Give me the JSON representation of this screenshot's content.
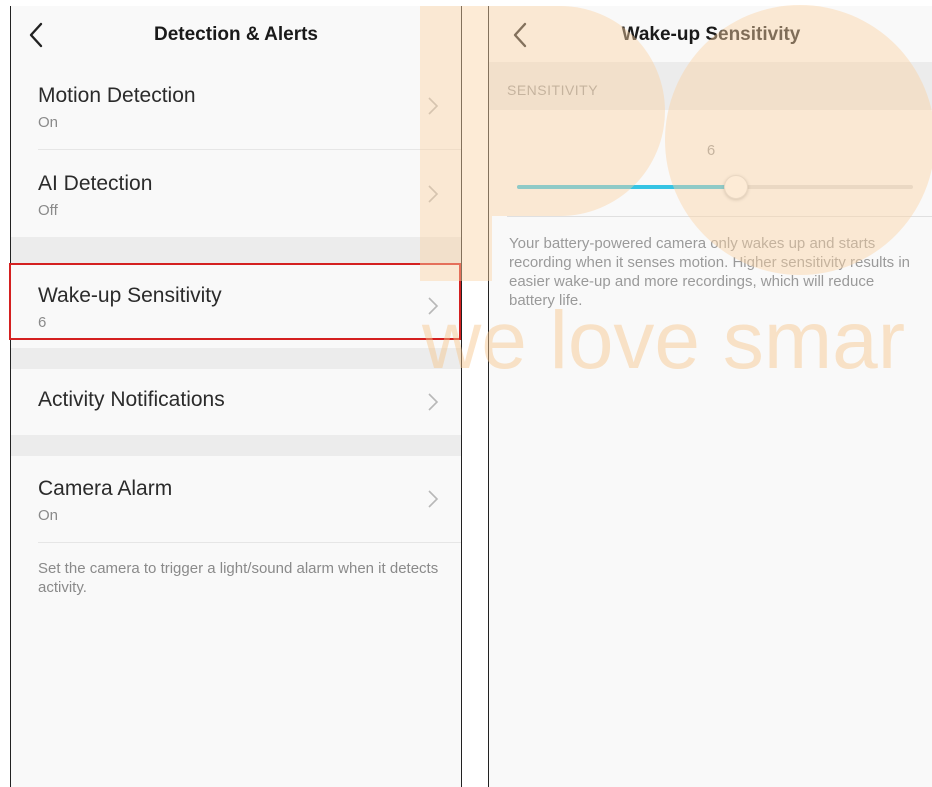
{
  "left": {
    "nav_title": "Detection & Alerts",
    "rows": [
      {
        "title": "Motion Detection",
        "subtitle": "On"
      },
      {
        "title": "AI Detection",
        "subtitle": "Off"
      },
      {
        "title": "Wake-up Sensitivity",
        "subtitle": "6"
      },
      {
        "title": "Activity Notifications"
      },
      {
        "title": "Camera Alarm",
        "subtitle": "On"
      }
    ],
    "footnote": "Set the camera to trigger a light/sound alarm when it detects activity."
  },
  "right": {
    "nav_title": "Wake-up Sensitivity",
    "section_header": "SENSITIVITY",
    "slider": {
      "value": "6",
      "fraction": 0.55
    },
    "description": "Your battery-powered camera only wakes up and starts recording when it senses motion. Higher sensitivity results in easier wake-up and more recordings, which will reduce battery life."
  },
  "watermark": {
    "text": "we love smar",
    "color": "#f7c58a"
  },
  "colors": {
    "accent": "#36c4e4",
    "highlight": "#d42020"
  },
  "icons": {
    "back": "chevron-left-icon",
    "row_arrow": "chevron-right-icon"
  }
}
